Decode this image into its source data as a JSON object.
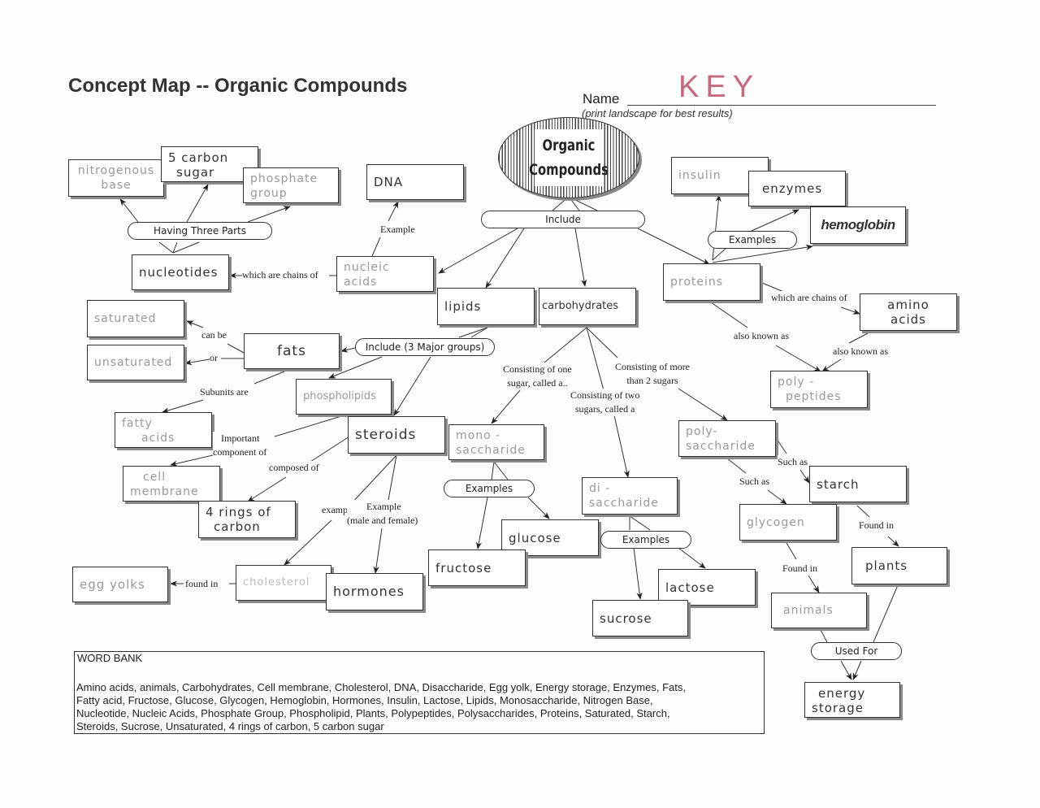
{
  "header": {
    "title": "Concept Map -- Organic Compounds",
    "name_label": "Name",
    "name_value": "KEY",
    "print_note": "(print landscape for best results)"
  },
  "hub": {
    "line1": "Organic",
    "line2": "Compounds"
  },
  "nodes": {
    "nitrogenous_base": {
      "line1": "nitrogenous",
      "line2": "base"
    },
    "five_carbon_sugar": {
      "line1": "5 carbon",
      "line2": "sugar"
    },
    "phosphate_group": {
      "line1": "phosphate",
      "line2": "group"
    },
    "dna": "DNA",
    "nucleotides": "nucleotides",
    "nucleic_acids": {
      "line1": "nucleic",
      "line2": "acids"
    },
    "lipids": "lipids",
    "carbohydrates": "carbohydrates",
    "insulin": "insulin",
    "enzymes": "enzymes",
    "hemoglobin": "hemoglobin",
    "proteins": "proteins",
    "amino_acids": {
      "line1": "amino",
      "line2": "acids"
    },
    "polypeptides": {
      "line1": "poly -",
      "line2": "peptides"
    },
    "saturated": "saturated",
    "unsaturated": "unsaturated",
    "fats": "fats",
    "phospholipids": "phospholipids",
    "fatty_acids": {
      "line1": "fatty",
      "line2": "acids"
    },
    "steroids": "steroids",
    "cell_membrane": {
      "line1": "cell",
      "line2": "membrane"
    },
    "four_rings": {
      "line1": "4 rings of",
      "line2": "carbon"
    },
    "egg_yolks": "egg yolks",
    "cholesterol": "cholesterol",
    "hormones": "hormones",
    "monosaccharide": {
      "line1": "mono -",
      "line2": "saccharide"
    },
    "disaccharide": {
      "line1": "di -",
      "line2": "saccharide"
    },
    "polysaccharide": {
      "line1": "poly-",
      "line2": "saccharide"
    },
    "glucose": "glucose",
    "fructose": "fructose",
    "lactose": "lactose",
    "sucrose": "sucrose",
    "starch": "starch",
    "glycogen": "glycogen",
    "plants": "plants",
    "animals": "animals",
    "energy_storage": {
      "line1": "energy",
      "line2": "storage"
    }
  },
  "pills": {
    "include": "Include",
    "having_three_parts": "Having Three Parts",
    "examples_proteins": "Examples",
    "include_lipids": "Include (3 Major groups)",
    "examples_mono": "Examples",
    "examples_di": "Examples",
    "used_for": "Used For"
  },
  "labels": {
    "example_dna": "Example",
    "chains_of_nucleotides": "which are chains of",
    "chains_of_amino": "which are chains of",
    "can_be": "can be",
    "or": "or",
    "subunits_are": "Subunits are",
    "important_component": {
      "line1": "Important",
      "line2": "component of"
    },
    "composed_of": "composed of",
    "example_cholesterol": "example",
    "example_hormones": {
      "line1": "Example",
      "line2": "(male and female)"
    },
    "found_in_egg": "found in",
    "also_known_as_1": "also known as",
    "also_known_as_2": "also known as",
    "one_sugar": {
      "line1": "Consisting of one",
      "line2": "sugar, called a.."
    },
    "two_sugars": {
      "line1": "Consisting of two",
      "line2": "sugars, called a"
    },
    "more_sugars": {
      "line1": "Consisting of more",
      "line2": "than 2 sugars"
    },
    "such_as_starch": "Such as",
    "such_as_glycogen": "Such as",
    "found_in_plants": "Found in",
    "found_in_animals": "Found in"
  },
  "word_bank": {
    "title": "WORD BANK",
    "lines": [
      "Amino acids, animals, Carbohydrates, Cell membrane, Cholesterol, DNA, Disaccharide, Egg yolk, Energy storage, Enzymes, Fats,",
      "Fatty acid, Fructose, Glucose, Glycogen, Hemoglobin, Hormones, Insulin, Lactose, Lipids, Monosaccharide, Nitrogen Base,",
      "Nucleotide, Nucleic Acids, Phosphate Group, Phospholipid, Plants, Polypeptides, Polysaccharides, Proteins, Saturated, Starch,",
      "Steroids, Sucrose, Unsaturated, 4 rings of carbon, 5 carbon sugar"
    ]
  }
}
